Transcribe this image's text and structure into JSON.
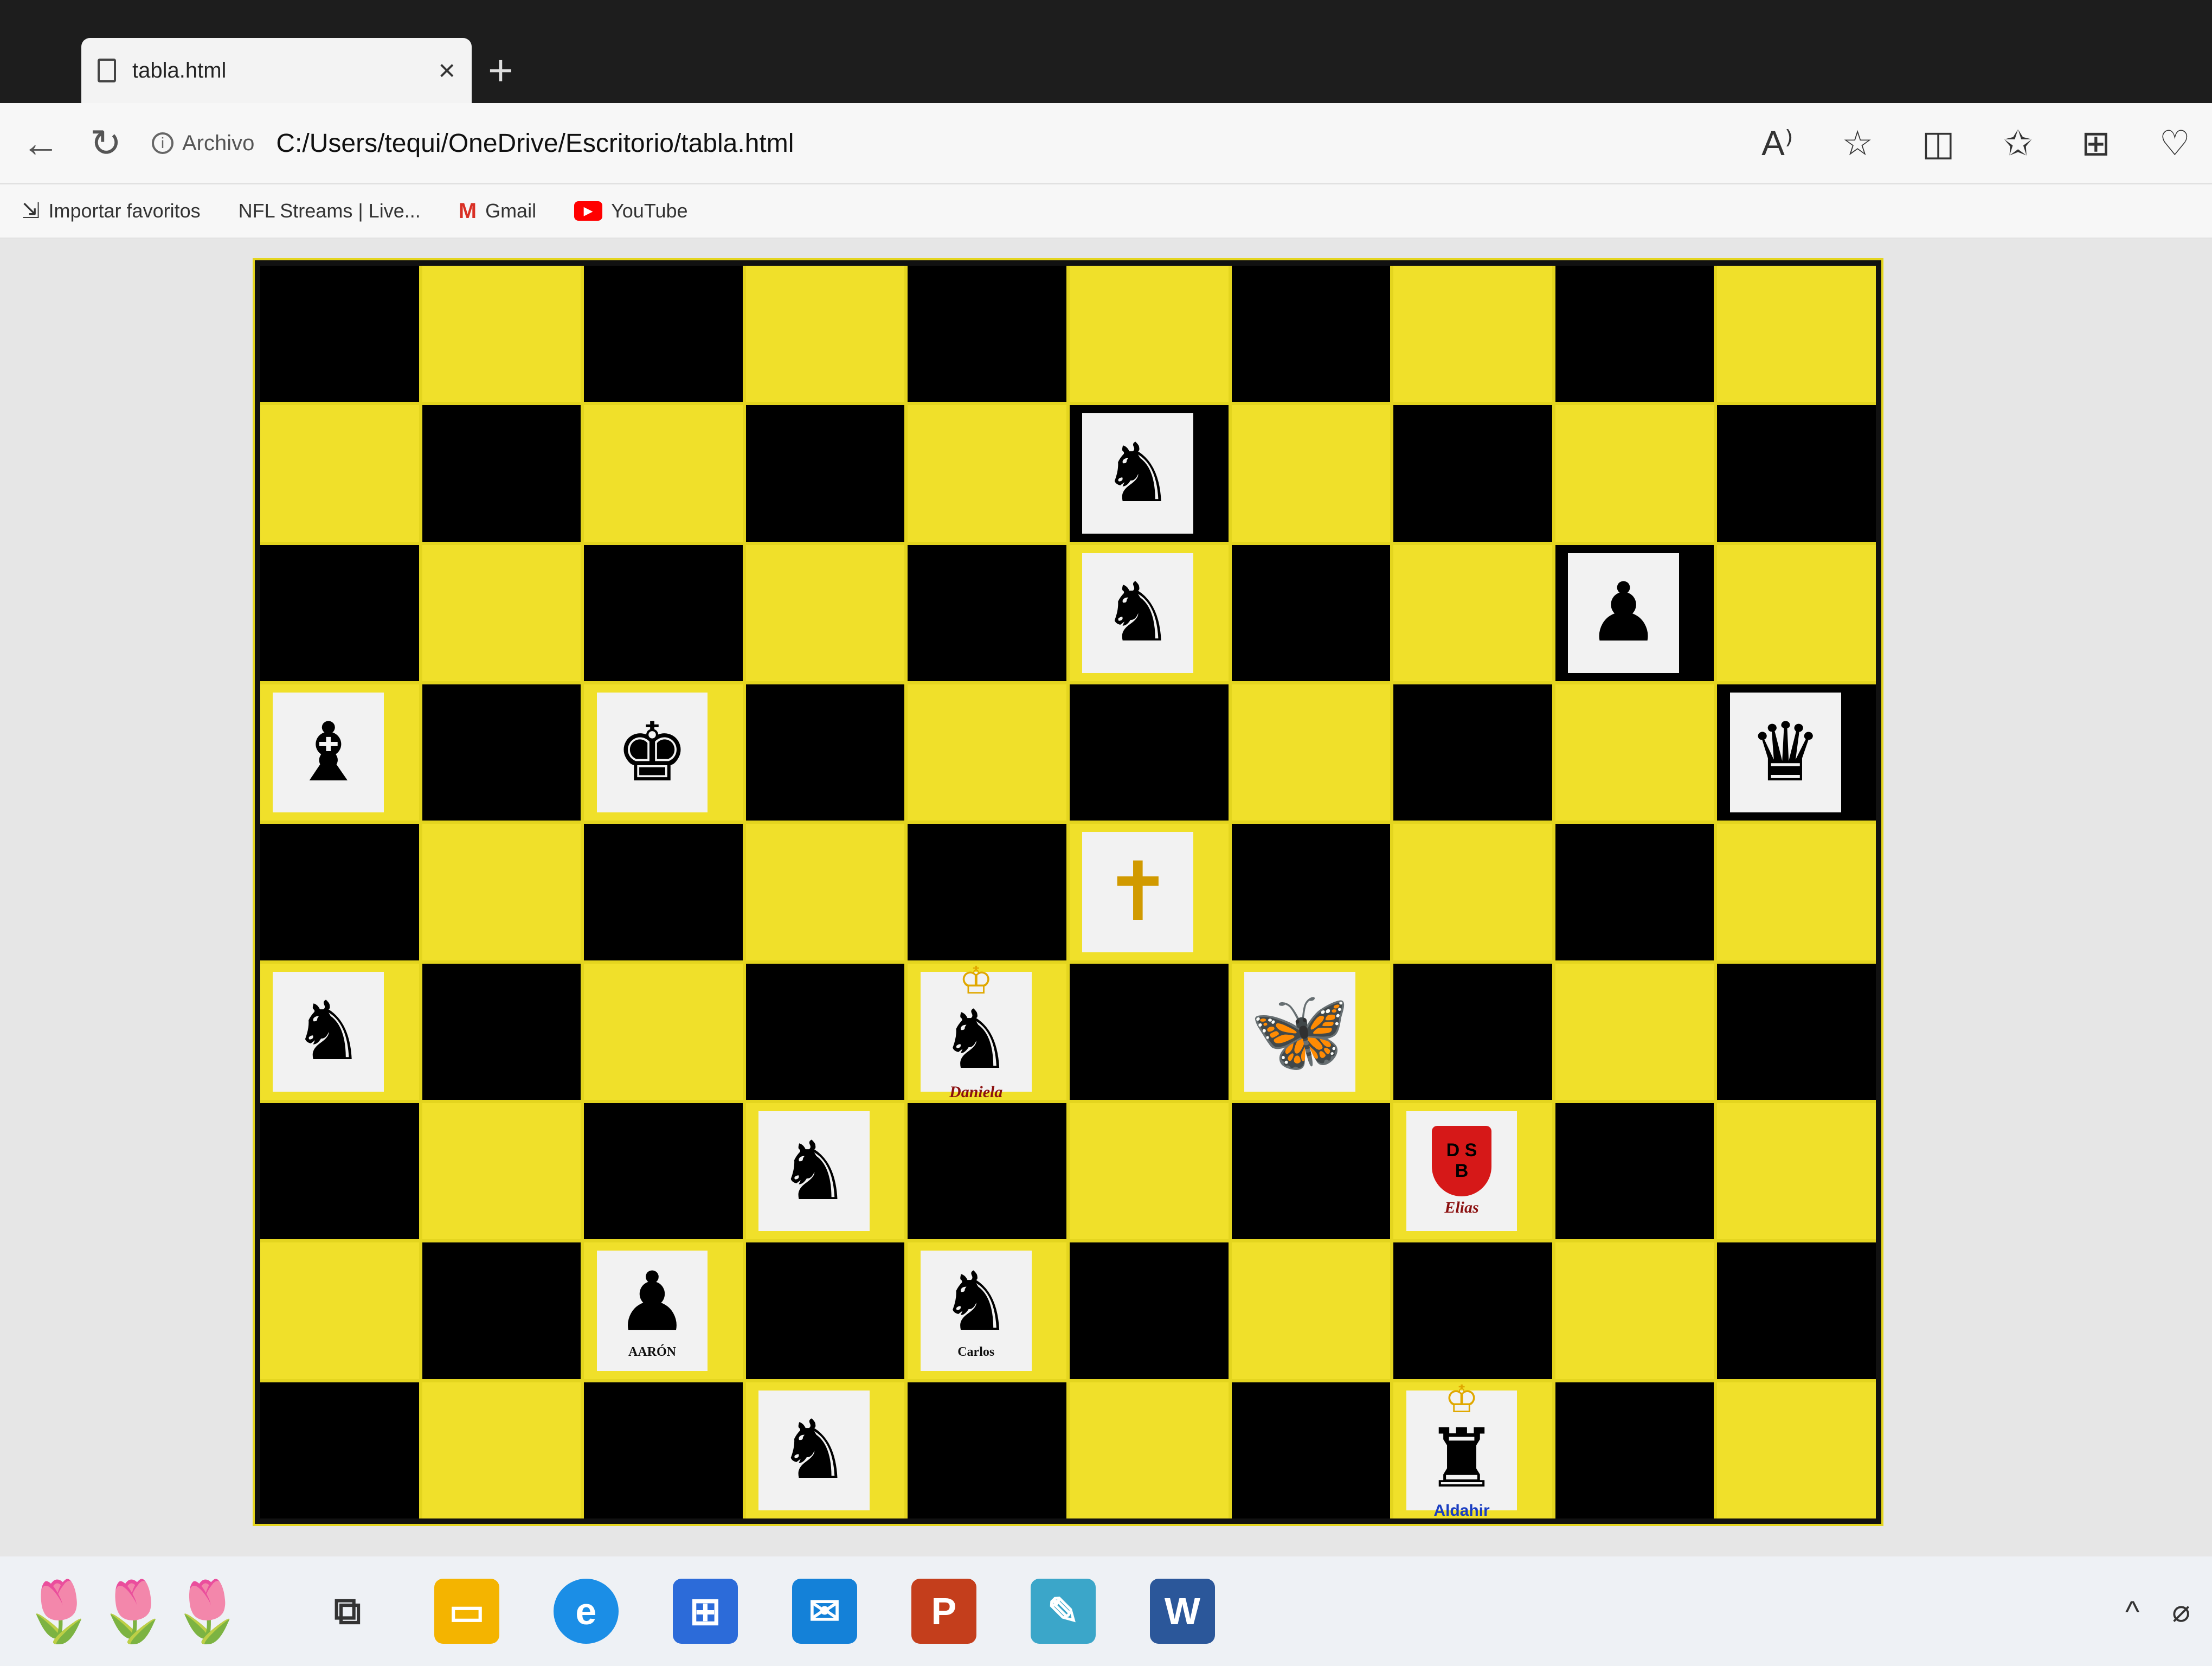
{
  "browser": {
    "tab": {
      "title": "tabla.html",
      "close": "×"
    },
    "new_tab": "+",
    "nav": {
      "back": "←",
      "refresh": "↻"
    },
    "security_chip": "Archivo",
    "url": "C:/Users/tequi/OneDrive/Escritorio/tabla.html",
    "toolbar_icons": [
      "read-aloud-icon",
      "favorite-star-icon",
      "split-screen-icon",
      "favorites-list-icon",
      "collections-icon",
      "performance-icon"
    ],
    "favorites": [
      {
        "label": "Importar favoritos",
        "icon": "⇲"
      },
      {
        "label": "NFL Streams | Live...",
        "icon": ""
      },
      {
        "label": "Gmail",
        "icon": "M"
      },
      {
        "label": "YouTube",
        "icon": "▶"
      }
    ]
  },
  "board": {
    "rows": 9,
    "cols": 10,
    "colors": {
      "yellow": "#f0e02a",
      "black": "#000000"
    },
    "pieces": {
      "1-5": {
        "glyph": "♞",
        "label": ""
      },
      "2-5": {
        "glyph": "♞",
        "label": ""
      },
      "2-8": {
        "glyph": "♟",
        "label": ""
      },
      "3-0": {
        "glyph": "♝",
        "label": ""
      },
      "3-2": {
        "glyph": "♚",
        "label": ""
      },
      "3-9": {
        "glyph": "♛",
        "label": ""
      },
      "4-5": {
        "glyph": "✝",
        "label": "",
        "gold": true
      },
      "5-0": {
        "glyph": "♞",
        "label": ""
      },
      "5-4": {
        "glyph": "♞",
        "label": "Daniela",
        "crown": "♔"
      },
      "5-6": {
        "glyph": "🦋",
        "label": ""
      },
      "6-3": {
        "glyph": "♞",
        "label": ""
      },
      "6-7": {
        "shield": "D S\nB",
        "label": "Elias"
      },
      "7-2": {
        "glyph": "♟",
        "label": "AARÓN",
        "dark": true
      },
      "7-4": {
        "glyph": "♞",
        "label": "Carlos",
        "dark": true
      },
      "8-3": {
        "glyph": "♞",
        "label": ""
      },
      "8-7": {
        "glyph": "♜",
        "label": "Aldahir",
        "crown": "♔",
        "blue": true
      }
    }
  },
  "taskbar": {
    "apps": [
      "task-view",
      "file-explorer",
      "edge",
      "store",
      "mail",
      "powerpoint",
      "notepad",
      "word"
    ],
    "tray": [
      "^",
      "⌀"
    ]
  }
}
